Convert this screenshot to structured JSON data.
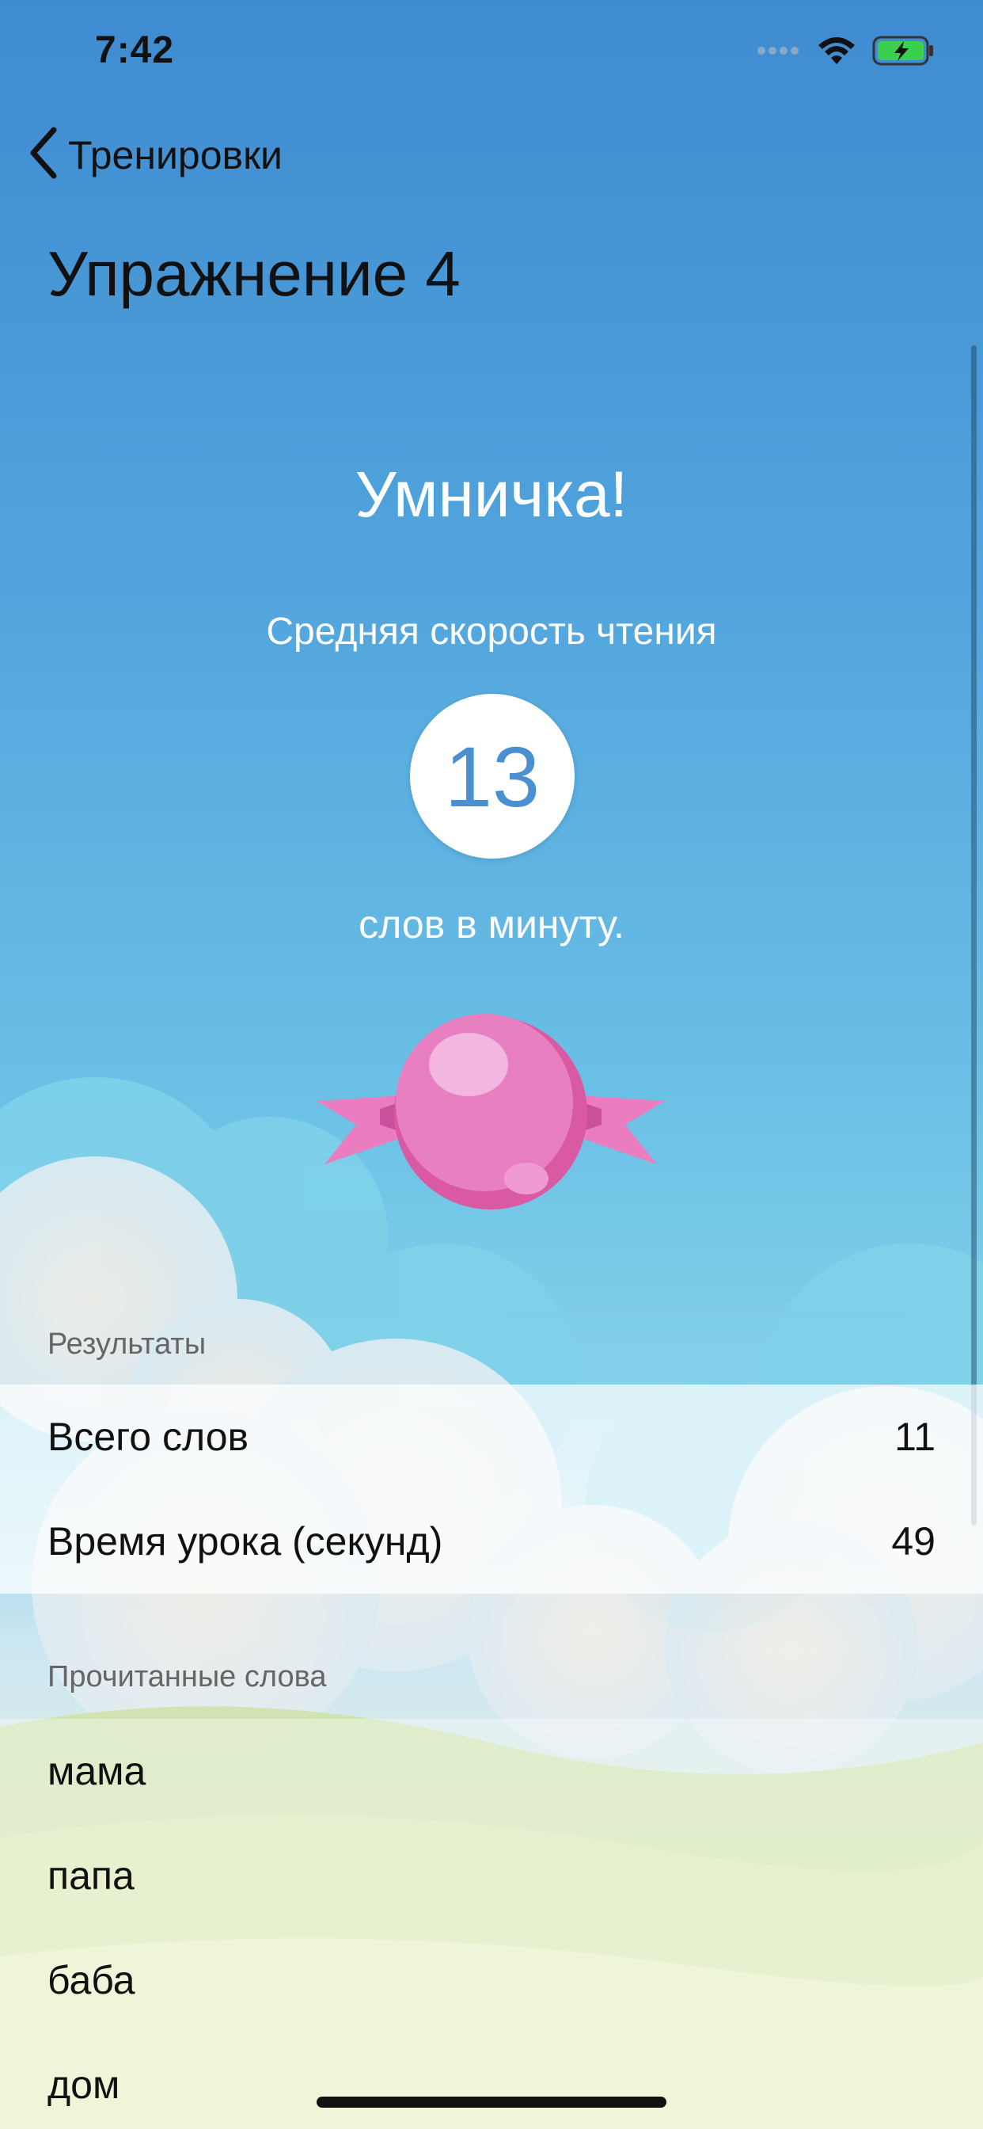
{
  "status_bar": {
    "time": "7:42"
  },
  "nav": {
    "back_label": "Тренировки",
    "title": "Упражнение 4"
  },
  "result": {
    "headline": "Умничка!",
    "subtitle": "Средняя скорость чтения",
    "speed_value": "13",
    "unit": "слов в минуту."
  },
  "results_section": {
    "header": "Результаты",
    "rows": [
      {
        "label": "Всего слов",
        "value": "11"
      },
      {
        "label": "Время урока (секунд)",
        "value": "49"
      }
    ]
  },
  "words_section": {
    "header": "Прочитанные слова",
    "items": [
      "мама",
      "папа",
      "баба",
      "дом"
    ]
  },
  "colors": {
    "accent": "#4a8fd0",
    "candy": "#e57dbd"
  },
  "icons": [
    "chevron-left-icon",
    "signal-icon",
    "wifi-icon",
    "battery-charging-icon",
    "candy-icon"
  ]
}
